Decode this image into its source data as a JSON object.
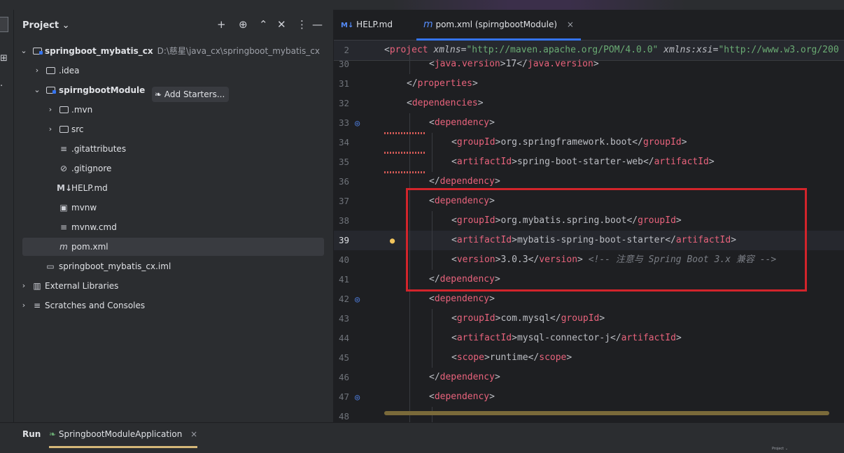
{
  "project_panel": {
    "title": "Project",
    "title_chevron": "⌄",
    "tools": {
      "add": "+",
      "locate": "⊕",
      "expand": "⌃",
      "collapse": "✕",
      "more": "⋮",
      "hide": "—"
    },
    "tree": [
      {
        "label": "springboot_mybatis_cx",
        "path": "D:\\慈星\\java_cx\\springboot_mybatis_cx",
        "icon": "module-folder-icon",
        "expanded": true,
        "depth": 0
      },
      {
        "label": ".idea",
        "icon": "folder-icon",
        "expanded": false,
        "depth": 1
      },
      {
        "label": "spirngbootModule",
        "icon": "module-folder-icon",
        "expanded": true,
        "depth": 1
      },
      {
        "label": ".mvn",
        "icon": "folder-icon",
        "expanded": false,
        "depth": 2
      },
      {
        "label": "src",
        "icon": "folder-icon",
        "expanded": false,
        "depth": 2
      },
      {
        "label": ".gitattributes",
        "icon": "text-file-icon",
        "depth": 2
      },
      {
        "label": ".gitignore",
        "icon": "ignore-file-icon",
        "depth": 2
      },
      {
        "label": "HELP.md",
        "icon": "markdown-icon",
        "depth": 2
      },
      {
        "label": "mvnw",
        "icon": "shell-script-icon",
        "depth": 2
      },
      {
        "label": "mvnw.cmd",
        "icon": "text-file-icon",
        "depth": 2
      },
      {
        "label": "pom.xml",
        "icon": "maven-icon",
        "depth": 2,
        "selected": true
      },
      {
        "label": "springboot_mybatis_cx.iml",
        "icon": "iml-file-icon",
        "depth": 1
      },
      {
        "label": "External Libraries",
        "icon": "library-icon",
        "expanded": false,
        "depth": 0
      },
      {
        "label": "Scratches and Consoles",
        "icon": "scratches-icon",
        "expanded": false,
        "depth": 0
      }
    ]
  },
  "editor": {
    "tabs": [
      {
        "label": "HELP.md",
        "icon": "markdown-icon",
        "active": false
      },
      {
        "label": "pom.xml (spirngbootModule)",
        "icon": "maven-icon",
        "active": true,
        "close": "×"
      }
    ],
    "sticky_line": {
      "number": "2",
      "open": "<",
      "tag": "project",
      "attr1": " xmlns",
      "eq1": "=",
      "val1": "\"http://maven.apache.org/POM/4.0.0\"",
      "attr2": " xmlns:xsi",
      "eq2": "=",
      "val2": "\"http://www.w3.org/200"
    },
    "inlay_hint": "Add Starters...",
    "lines": [
      {
        "n": "30",
        "indent": 2,
        "open": "java.version",
        "text": "17",
        "close": "java.version"
      },
      {
        "n": "31",
        "indent": 1,
        "closeonly": "properties"
      },
      {
        "n": "32",
        "indent": 1,
        "openonly": "dependencies"
      },
      {
        "n": "33",
        "indent": 2,
        "openonly": "dependency"
      },
      {
        "n": "34",
        "indent": 3,
        "open": "groupId",
        "text": "org.springframework.boot",
        "close": "groupId"
      },
      {
        "n": "35",
        "indent": 3,
        "open": "artifactId",
        "text": "spring-boot-starter-web",
        "close": "artifactId"
      },
      {
        "n": "36",
        "indent": 2,
        "closeonly": "dependency"
      },
      {
        "n": "37",
        "indent": 2,
        "openonly": "dependency"
      },
      {
        "n": "38",
        "indent": 3,
        "open": "groupId",
        "text": "org.mybatis.spring.boot",
        "close": "groupId"
      },
      {
        "n": "39",
        "indent": 3,
        "open": "artifactId",
        "text": "mybatis-spring-boot-starter",
        "close": "artifactId"
      },
      {
        "n": "40",
        "indent": 3,
        "open": "version",
        "text": "3.0.3",
        "close": "version",
        "comment": "<!-- 注意与 Spring Boot 3.x 兼容 -->"
      },
      {
        "n": "41",
        "indent": 2,
        "closeonly": "dependency"
      },
      {
        "n": "42",
        "indent": 2,
        "openonly": "dependency"
      },
      {
        "n": "43",
        "indent": 3,
        "open": "groupId",
        "text": "com.mysql",
        "close": "groupId"
      },
      {
        "n": "44",
        "indent": 3,
        "open": "artifactId",
        "text": "mysql-connector-j",
        "close": "artifactId"
      },
      {
        "n": "45",
        "indent": 3,
        "open": "scope",
        "text": "runtime",
        "close": "scope"
      },
      {
        "n": "46",
        "indent": 2,
        "closeonly": "dependency"
      },
      {
        "n": "47",
        "indent": 2,
        "openonly": "dependency"
      },
      {
        "n": "48",
        "indent": 3,
        "open": "",
        "text": "",
        "close": ""
      }
    ]
  },
  "bottom_bar": {
    "run_label": "Run",
    "run_tab": "SpringbootModuleApplication",
    "run_tab_close": "×",
    "tiny_text": "Project ⌄"
  },
  "colors": {
    "accent": "#3574f0",
    "highlight_box": "#d3242b",
    "tag": "#d5b778",
    "string": "#6aab73"
  }
}
